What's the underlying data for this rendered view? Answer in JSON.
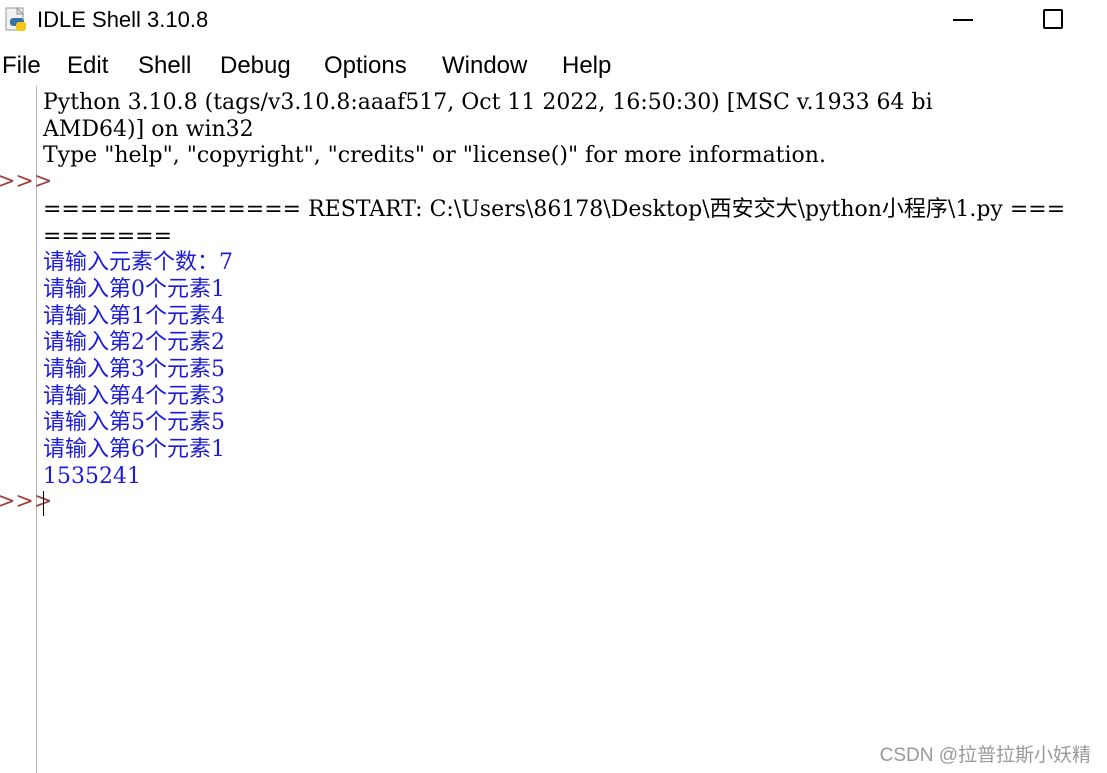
{
  "window": {
    "title": "IDLE Shell 3.10.8"
  },
  "menu": [
    "File",
    "Edit",
    "Shell",
    "Debug",
    "Options",
    "Window",
    "Help"
  ],
  "shell": {
    "prompt": ">>>",
    "banner": [
      "Python 3.10.8 (tags/v3.10.8:aaaf517, Oct 11 2022, 16:50:30) [MSC v.1933 64 bi",
      "AMD64)] on win32",
      "Type \"help\", \"copyright\", \"credits\" or \"license()\" for more information."
    ],
    "restart": [
      "============== RESTART: C:\\Users\\86178\\Desktop\\西安交大\\python小程序\\1.py ===",
      "======="
    ],
    "run_output": [
      "请输入元素个数：7",
      "请输入第0个元素1",
      "请输入第1个元素4",
      "请输入第2个元素2",
      "请输入第3个元素5",
      "请输入第4个元素3",
      "请输入第5个元素5",
      "请输入第6个元素1",
      "1535241"
    ]
  },
  "watermark": "CSDN @拉普拉斯小妖精"
}
